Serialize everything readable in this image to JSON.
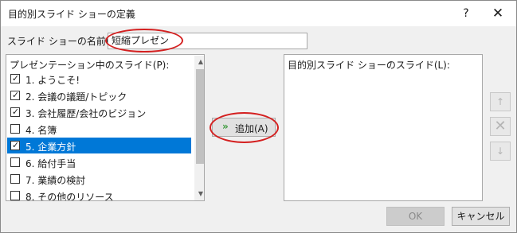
{
  "dialog": {
    "title": "目的別スライド ショーの定義",
    "help_glyph": "?",
    "close_glyph": "✕"
  },
  "name": {
    "label": "スライド ショーの名前(N):",
    "value": "短縮プレゼン"
  },
  "left_list": {
    "header": "プレゼンテーション中のスライド(P):",
    "items": [
      {
        "text": "1. ようこそ!",
        "checked": true,
        "selected": false
      },
      {
        "text": "2. 会議の議題/トピック",
        "checked": true,
        "selected": false
      },
      {
        "text": "3. 会社履歴/会社のビジョン",
        "checked": true,
        "selected": false
      },
      {
        "text": "4. 名簿",
        "checked": false,
        "selected": false
      },
      {
        "text": "5. 企業方針",
        "checked": true,
        "selected": true
      },
      {
        "text": "6. 給付手当",
        "checked": false,
        "selected": false
      },
      {
        "text": "7. 業績の検討",
        "checked": false,
        "selected": false
      },
      {
        "text": "8. その他のリソース",
        "checked": false,
        "selected": false
      }
    ],
    "scroll_up_glyph": "▲",
    "scroll_down_glyph": "▼"
  },
  "add_button": {
    "label": "追加(A)",
    "icon": "double-chevron-right-icon",
    "icon_glyph": "»"
  },
  "right_list": {
    "header": "目的別スライド ショーのスライド(L):"
  },
  "side_buttons": {
    "up_glyph": "↑",
    "delete_glyph": "✕",
    "down_glyph": "↓"
  },
  "footer": {
    "ok_label": "OK",
    "cancel_label": "キャンセル"
  },
  "colors": {
    "selection": "#0078d7",
    "highlight_annotation": "#d42020",
    "add_icon": "#3a9a3a"
  }
}
